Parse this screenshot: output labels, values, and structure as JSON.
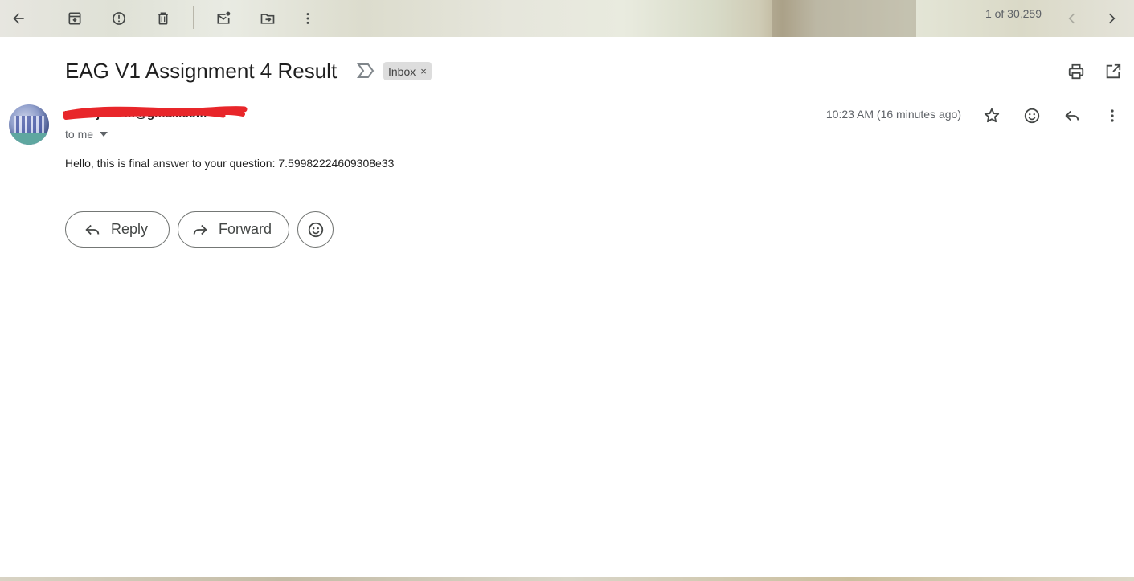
{
  "toolbar": {
    "back": "back-arrow-icon",
    "actions": [
      "archive-icon",
      "report-spam-icon",
      "delete-icon",
      "mark-unread-icon",
      "move-to-icon",
      "more-vert-icon"
    ],
    "pager_text": "1 of 30,259",
    "prev": "chevron-left-icon",
    "next": "chevron-right-icon"
  },
  "message": {
    "subject": "EAG V1 Assignment 4 Result",
    "label": "Inbox",
    "label_remove": "×",
    "sender": "mobajith24.f@gmail.com",
    "recipient": "to me",
    "timestamp": "10:23 AM (16 minutes ago)",
    "body": "Hello, this is final answer to your question: 7.59982224609308e33"
  },
  "buttons": {
    "reply": "Reply",
    "forward": "Forward"
  },
  "colors": {
    "redaction": "#e8262a",
    "icon": "#444746"
  }
}
